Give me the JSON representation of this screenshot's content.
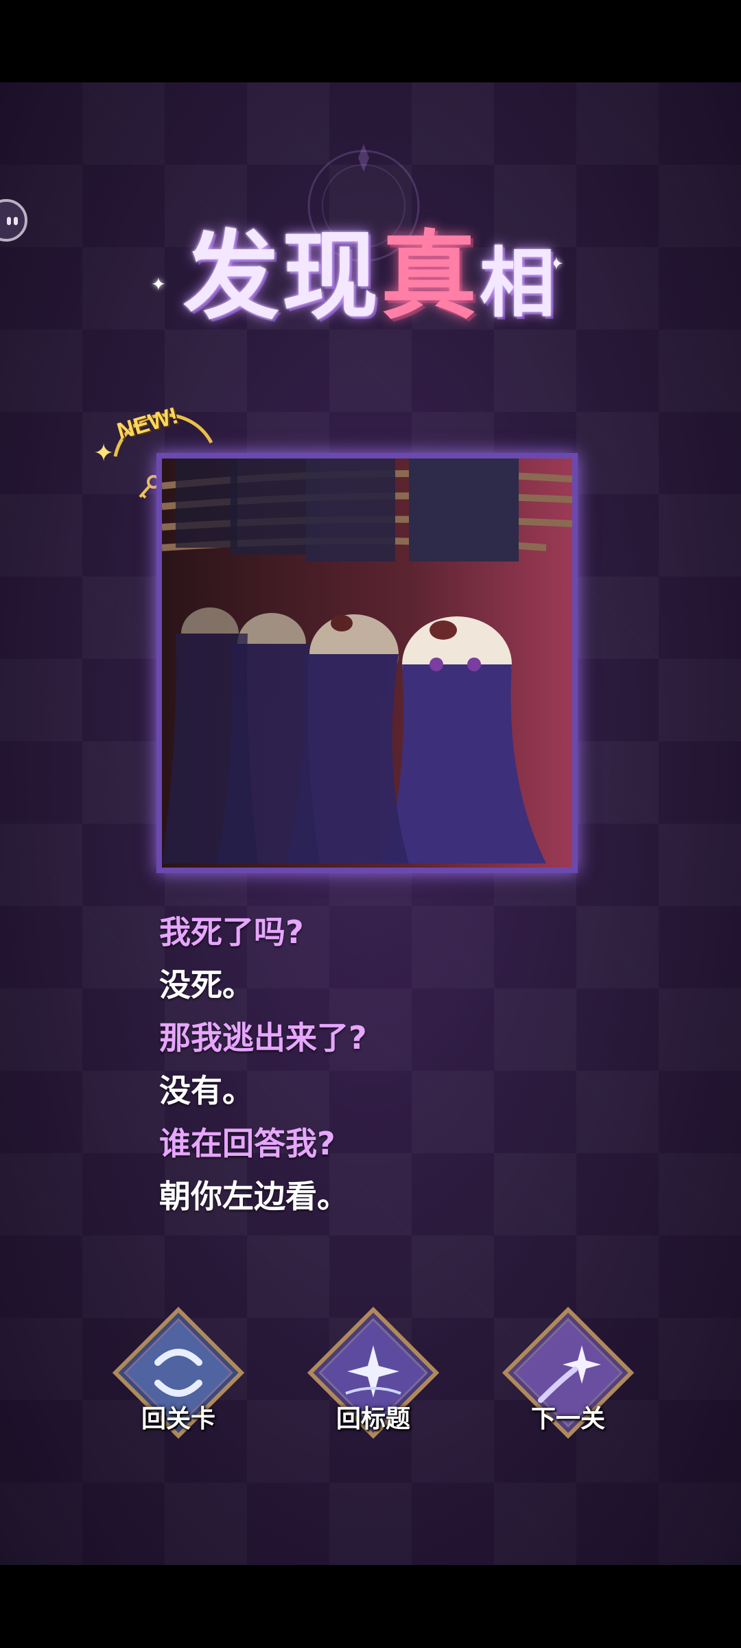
{
  "title": {
    "chars": [
      "发",
      "现",
      "真",
      "相"
    ],
    "accent_color": "#ff7fa6",
    "main_color": "#f3e8ff"
  },
  "reward": {
    "badge_text": "NEW!",
    "key_count": "+1",
    "icon": "key-icon"
  },
  "dialogue": [
    {
      "speaker": "self",
      "text": "我死了吗?"
    },
    {
      "speaker": "other",
      "text": "没死。"
    },
    {
      "speaker": "self",
      "text": "那我逃出来了?"
    },
    {
      "speaker": "other",
      "text": "没有。"
    },
    {
      "speaker": "self",
      "text": "谁在回答我?"
    },
    {
      "speaker": "other",
      "text": "朝你左边看。"
    }
  ],
  "colors": {
    "question_text": "#e7a6ff",
    "answer_text": "#ffffff",
    "background": "#2b1a3c",
    "frame": "#6a4ab0"
  },
  "buttons": [
    {
      "label": "回关卡",
      "icon": "restart-swirl-icon"
    },
    {
      "label": "回标题",
      "icon": "book-star-icon"
    },
    {
      "label": "下一关",
      "icon": "shooting-star-icon"
    }
  ]
}
